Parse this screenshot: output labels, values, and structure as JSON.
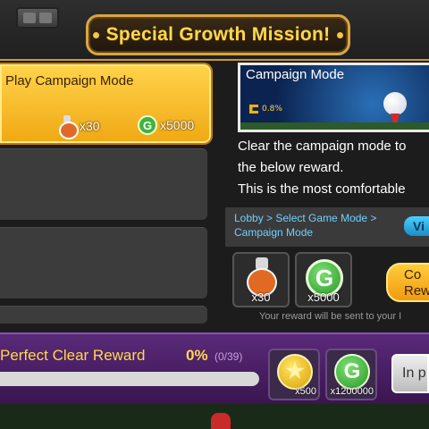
{
  "header": {
    "title": "Special Growth Mission!"
  },
  "missions": [
    {
      "name": "Play Campaign Mode",
      "rewards": [
        {
          "icon": "potion-icon",
          "qty": "x30"
        },
        {
          "icon": "g-coin-icon",
          "qty": "x5000"
        }
      ]
    }
  ],
  "detail": {
    "banner_title": "Campaign Mode",
    "banner_progress": "0.8%",
    "description_lines": [
      "Clear the campaign mode to",
      "the below reward.",
      "This is the most comfortable"
    ],
    "path_text": "Lobby > Select Game Mode > Campaign Mode",
    "view_button": "Vi",
    "rewards": [
      {
        "icon": "potion-icon",
        "qty": "x30"
      },
      {
        "icon": "g-coin-icon",
        "qty": "x5000",
        "glyph": "G"
      }
    ],
    "claim_button": "Co Rew",
    "note": "Your reward will be sent to your I"
  },
  "perfect_clear": {
    "label": "Perfect Clear Reward",
    "percent": "0%",
    "count": "(0/39)",
    "progress": 0,
    "rewards": [
      {
        "icon": "star-coin-icon",
        "qty": "x500"
      },
      {
        "icon": "g-coin-icon",
        "qty": "x1200000",
        "glyph": "G"
      }
    ],
    "status_button": "In p"
  },
  "colors": {
    "accent": "#ffd84a",
    "link": "#6fd0ff",
    "panel_purple": "#4a1f63"
  }
}
